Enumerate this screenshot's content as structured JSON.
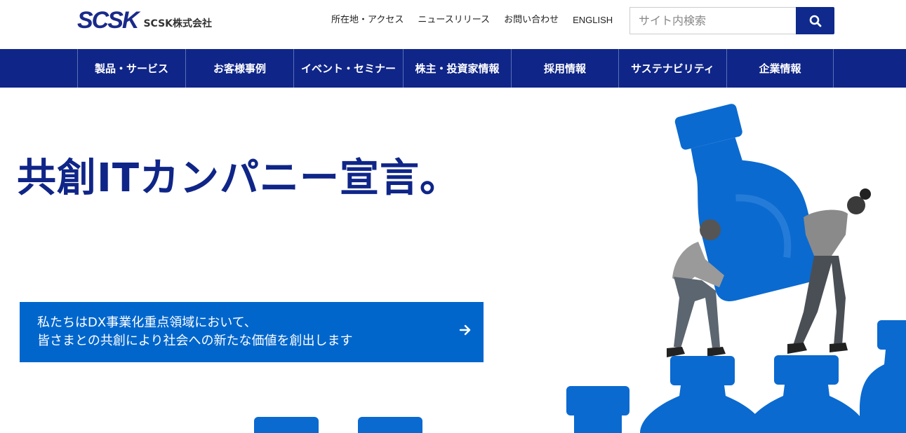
{
  "header": {
    "logo_mark": "SCSK",
    "logo_text": "SCSK株式会社",
    "util_links": [
      {
        "label": "所在地・アクセス"
      },
      {
        "label": "ニュースリリース"
      },
      {
        "label": "お問い合わせ"
      },
      {
        "label": "ENGLISH"
      }
    ],
    "search": {
      "placeholder": "サイト内検索",
      "value": ""
    }
  },
  "nav": {
    "items": [
      {
        "label": "製品・サービス"
      },
      {
        "label": "お客様事例"
      },
      {
        "label": "イベント・セミナー"
      },
      {
        "label": "株主・投資家情報"
      },
      {
        "label": "採用情報"
      },
      {
        "label": "サステナビリティ"
      },
      {
        "label": "企業情報"
      }
    ]
  },
  "hero": {
    "title": "共創ITカンパニー宣言。",
    "cta_line1": "私たちはDX事業化重点領域において、",
    "cta_line2": "皆さまとの共創により社会への新たな価値を創出します"
  },
  "colors": {
    "brand_navy": "#0f2588",
    "accent_blue": "#0066cc",
    "bottle_blue": "#0a6ad0"
  },
  "icons": {
    "search": "magnifier-icon",
    "cta": "arrow-right-icon"
  }
}
